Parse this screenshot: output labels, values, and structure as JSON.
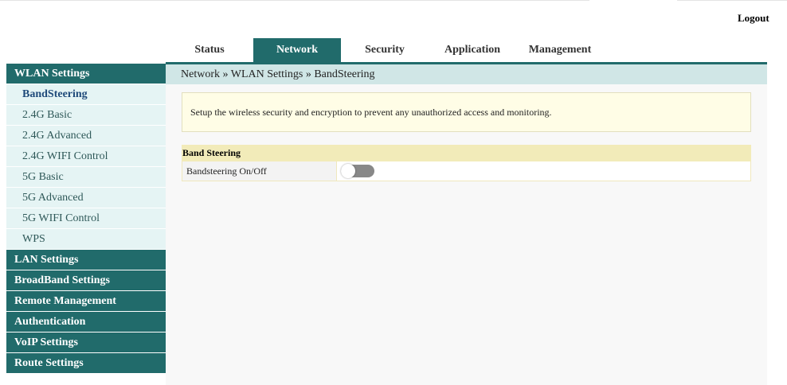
{
  "header": {
    "logout_label": "Logout"
  },
  "tabs": [
    {
      "label": "Status",
      "active": false
    },
    {
      "label": "Network",
      "active": true
    },
    {
      "label": "Security",
      "active": false
    },
    {
      "label": "Application",
      "active": false
    },
    {
      "label": "Management",
      "active": false
    }
  ],
  "sidebar": {
    "wlan_header": "WLAN Settings",
    "wlan_items": [
      "BandSteering",
      "2.4G Basic",
      "2.4G Advanced",
      "2.4G WIFI Control",
      "5G Basic",
      "5G Advanced",
      "5G WIFI Control",
      "WPS"
    ],
    "sections": [
      "LAN Settings",
      "BroadBand Settings",
      "Remote Management",
      "Authentication",
      "VoIP Settings",
      "Route Settings"
    ]
  },
  "main": {
    "breadcrumb": "Network » WLAN Settings » BandSteering",
    "info": "Setup the wireless security and encryption to prevent any unauthorized access and monitoring.",
    "section_title": "Band Steering",
    "row_label": "Bandsteering On/Off",
    "toggle_state": "off"
  },
  "colors": {
    "accent": "#216b6b",
    "sidebar_item_bg": "#e5f4f4",
    "breadcrumb_bg": "#d0e6e6",
    "info_bg": "#fffde6",
    "section_bg": "#f2ebb9"
  }
}
